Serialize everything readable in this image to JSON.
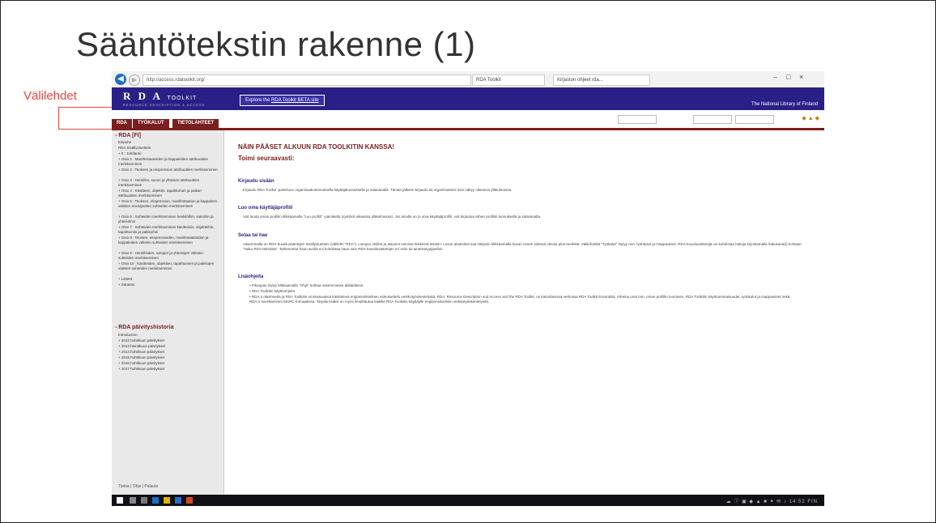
{
  "slide": {
    "title": "Sääntötekstin rakenne (1)",
    "callout_label": "Välilehdet"
  },
  "browser": {
    "address": "http://access.rdatoolkit.org/",
    "tabs": [
      "RDA Toolkit",
      "Kirjaston ohjeet rda..."
    ],
    "window_controls": [
      "–",
      "□",
      "×"
    ]
  },
  "banner": {
    "logo_main": "R D A",
    "logo_small": "TOOLKIT",
    "logo_sub": "RESOURCE DESCRIPTION & ACCESS",
    "beta_prefix": "Explore the ",
    "beta_link": "RDA Toolkit BETA site",
    "library": "The National Library of Finland"
  },
  "maintabs": [
    "RDA",
    "TYÖKALUT",
    "TIETOLÄHTEET"
  ],
  "toolbar": {
    "search1": "",
    "search2": "",
    "search3": ""
  },
  "sidebar": {
    "head1": "- RDA [FI]",
    "items1": [
      "Esipuhe",
      "RDA Sisällysluettelo",
      "+ 0 : Johdanto",
      "+ Osio 1 : Manifestaatioiden ja kappaleiden attribuuttien merkitseminen",
      "+ Osio 2 : Teoksen ja ekspression attribuuttien merkitseminen",
      "+ Osio 3 : Henkilön, suvun ja yhteisön attribuuttien merkitseminen",
      "+ Osio 4 : Käsitteen, objektin, tapahtuman ja paikan attribuuttien merkitseminen",
      "+ Osio 5 : Teoksen, ekspression, manifestaation ja kappaleen välisten ensisijaisten suhteiden merkitseminen",
      "+ Osio 6 : Suhteiden merkitseminen henkilöihin, sukuihin ja yhteisöihin",
      "+ Osio 7 : Suhteiden merkitseminen käsitteisiin, objekteihin, tapahtumiin ja paikkoihin",
      "+ Osio 8 : Teosten, ekspressioiden, manifestaatioiden ja kappaleiden välisten suhteiden merkitseminen",
      "+ Osio 9 : Henkilöiden, sukujen ja yhteisöjen välisten suhteiden merkitseminen",
      "+ Osio 10 : Käsitteiden, objektien, tapahtumien ja paikkojen välisten suhteiden merkitseminen",
      "+ Liitteet",
      "+ Sanasto"
    ],
    "head2": "- RDA päivityshistoria",
    "items2": [
      "Introduction",
      "+ 2012 huhtikuun päivitykset",
      "+ 2013 heinäkuun päivitykset",
      "+ 2014 huhtikuun päivitykset",
      "+ 2015 huhtikuun päivitykset",
      "+ 2016 huhtikuun päivitykset",
      "+ 2017 huhtikuun päivitykset"
    ],
    "footer": "Tietoa  |  Ohje  |  Palaute"
  },
  "content": {
    "h1": "NÄIN PÄÄSET ALKUUN RDA TOOLKITIN KANSSA!",
    "h2": "Toimi seuraavasti:",
    "sections": [
      {
        "title": "Kirjaudu sisään",
        "text": "Kirjaudu RDA Toolkit -palveluun organisaatiotunnuksella käyttäjätunnuksella ja salasanalla. Tämän jälkeen kirjaudu tai organisaatiosi mini näkyy oikeassa yläkulmassa."
      },
      {
        "title": "Luo oma käyttäjäprofiili",
        "text": "Voit luoda oman profiilin klikkaamalla \"Luo profiili\" -painiketta (symboli oikeassa yläkulmassa). Jos sinulla on jo oma käyttäjäprofiili, voit kirjautua siihen profiilin tunnuksella ja salasanalla."
      },
      {
        "title": "Selaa tai hae",
        "text": "Vasemmalla on RDA-kuvailusääntöjen sisällysluettelo (välilehti \"RDA\"). Lukujen otsikot ja alaosiot toimivat linkkeinä tekstiin. Luvun alaotsikot saa näkyviin klikkaamalla kuvun nimen edessä olevaa plus-merkkiä. Välilehdeltä \"Työkalut\" löytyy mm. työnkulut ja mappaukset. RDA-kuvailusääntöjä voi kohdistaa hakuja kirjoittamalla hakusana(t) kohtaan \"Hako RDA-tekstistä\". Tarkennetut haun avulla voi kohdistaa haun vain RDA-kuvailusääntöjen eri osiin tai aineistotyyppeihin."
      }
    ],
    "more_title": "Lisäohjeita",
    "bullets": [
      "Pikaopas löytyy klikkaamalla \"Ohje\" kohtaa vasemmassa alalaidassa",
      "RDA Toolkitin käyttöohjeita",
      "RDA:n rakennetta ja RDA Toolkitin ominaisuuksia käsittelevä englanninkielinen videoluettelo verkkotyöskentelystä, RDA: Resource Description and Access and the RDA Toolkit, on katsottavissa verkossa RDA Toolkit Essentials. Aiheina ovat mm. oman profiilin luominen, RDA Toolkitin käyttöominaisuudet, työnkulut ja mappaukset sekä RDA:n soveltaminen MARC-formaatissa. Tarjolla lisäksi on myös ilmoittautua kaikille RDA Toolkitin käyttäjille englanninkielisiin verkkotyöskentelyistä."
    ]
  },
  "taskbar": {
    "tray": "☁ ⓘ ▣ ◆ ▲ ■ ✦ ✉ ♪ 14:52 FIN"
  }
}
